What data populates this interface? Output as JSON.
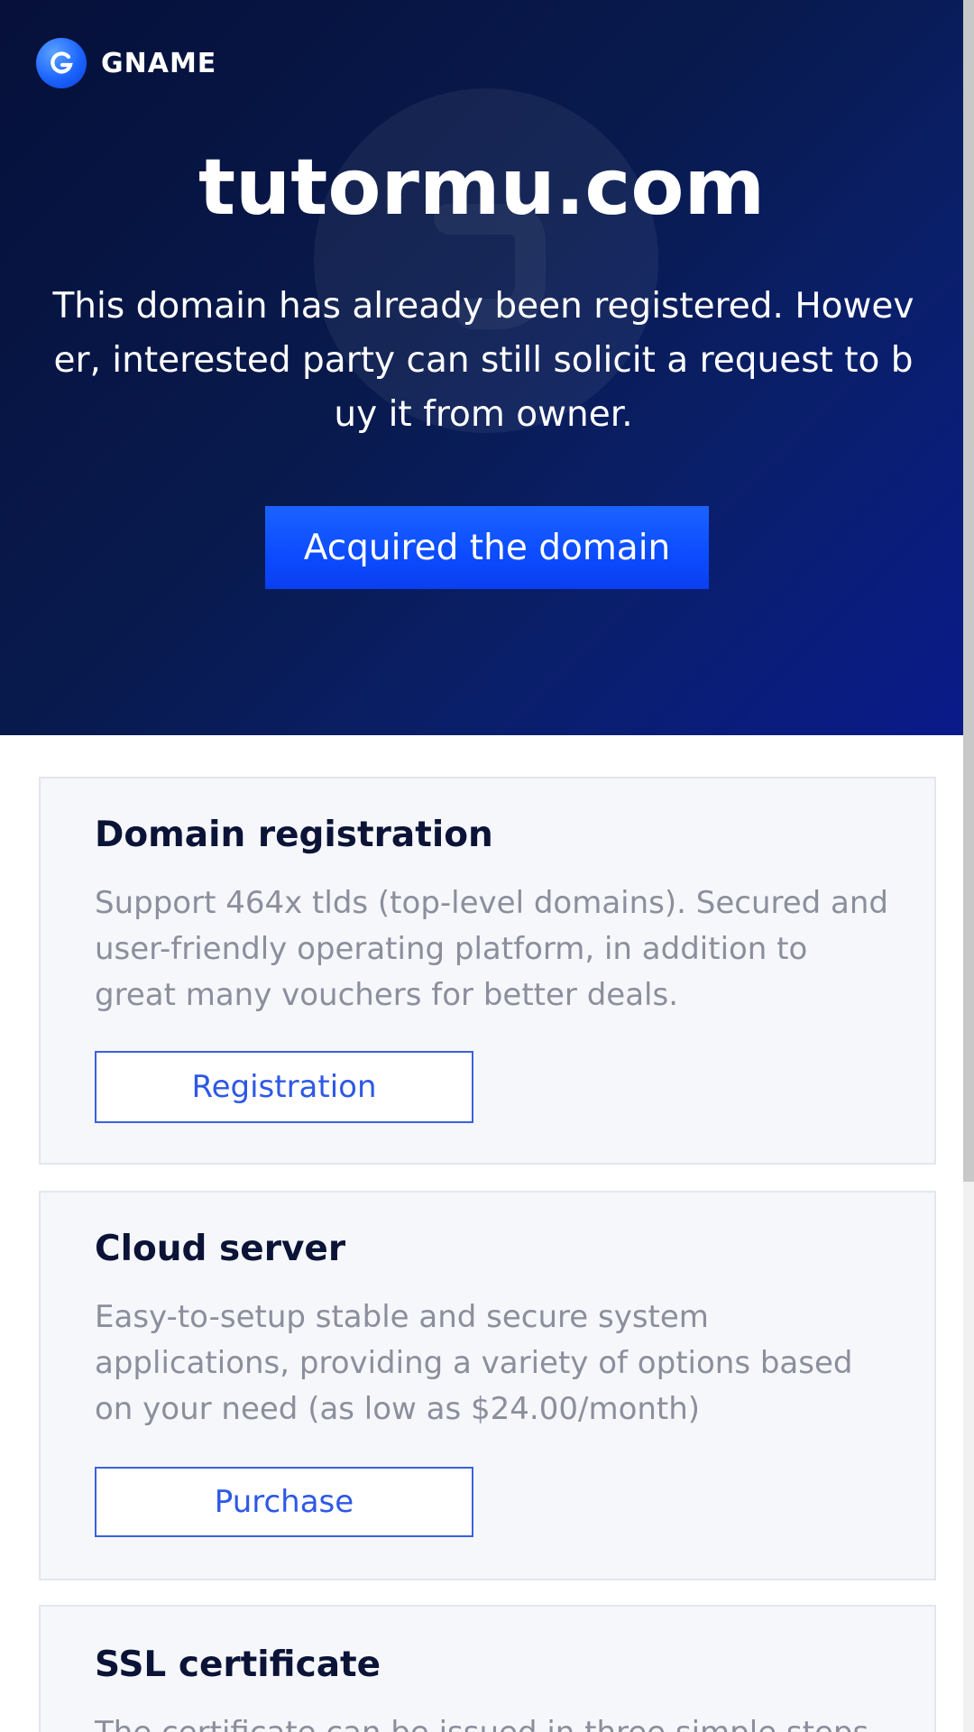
{
  "brand": {
    "name": "GNAME"
  },
  "hero": {
    "domain": "tutormu.com",
    "description": "This domain has already been registered. However, interested party can still solicit a request to buy it from owner.",
    "cta_label": "Acquired the domain"
  },
  "cards": [
    {
      "title": "Domain registration",
      "description": "Support 464x tlds (top-level domains). Secured and user-friendly operating platform, in addition to great many vouchers for better deals.",
      "button_label": "Registration"
    },
    {
      "title": "Cloud server",
      "description": "Easy-to-setup stable and secure system applications, providing a variety of options based on your need (as low as $24.00/month)",
      "button_label": "Purchase"
    },
    {
      "title": "SSL certificate",
      "description": "The certificate can be issued in three simple steps"
    }
  ],
  "colors": {
    "hero_bg_start": "#06103a",
    "hero_bg_end": "#0a1a8a",
    "accent_blue": "#0c4bff",
    "outline_blue": "#3a60e0",
    "card_bg": "#f6f7fb",
    "title_dark": "#0b1437",
    "desc_gray": "#8b8f9c"
  },
  "icons": {
    "brand_logo": "gname-g-logo-icon",
    "watermark": "gname-watermark-icon"
  }
}
